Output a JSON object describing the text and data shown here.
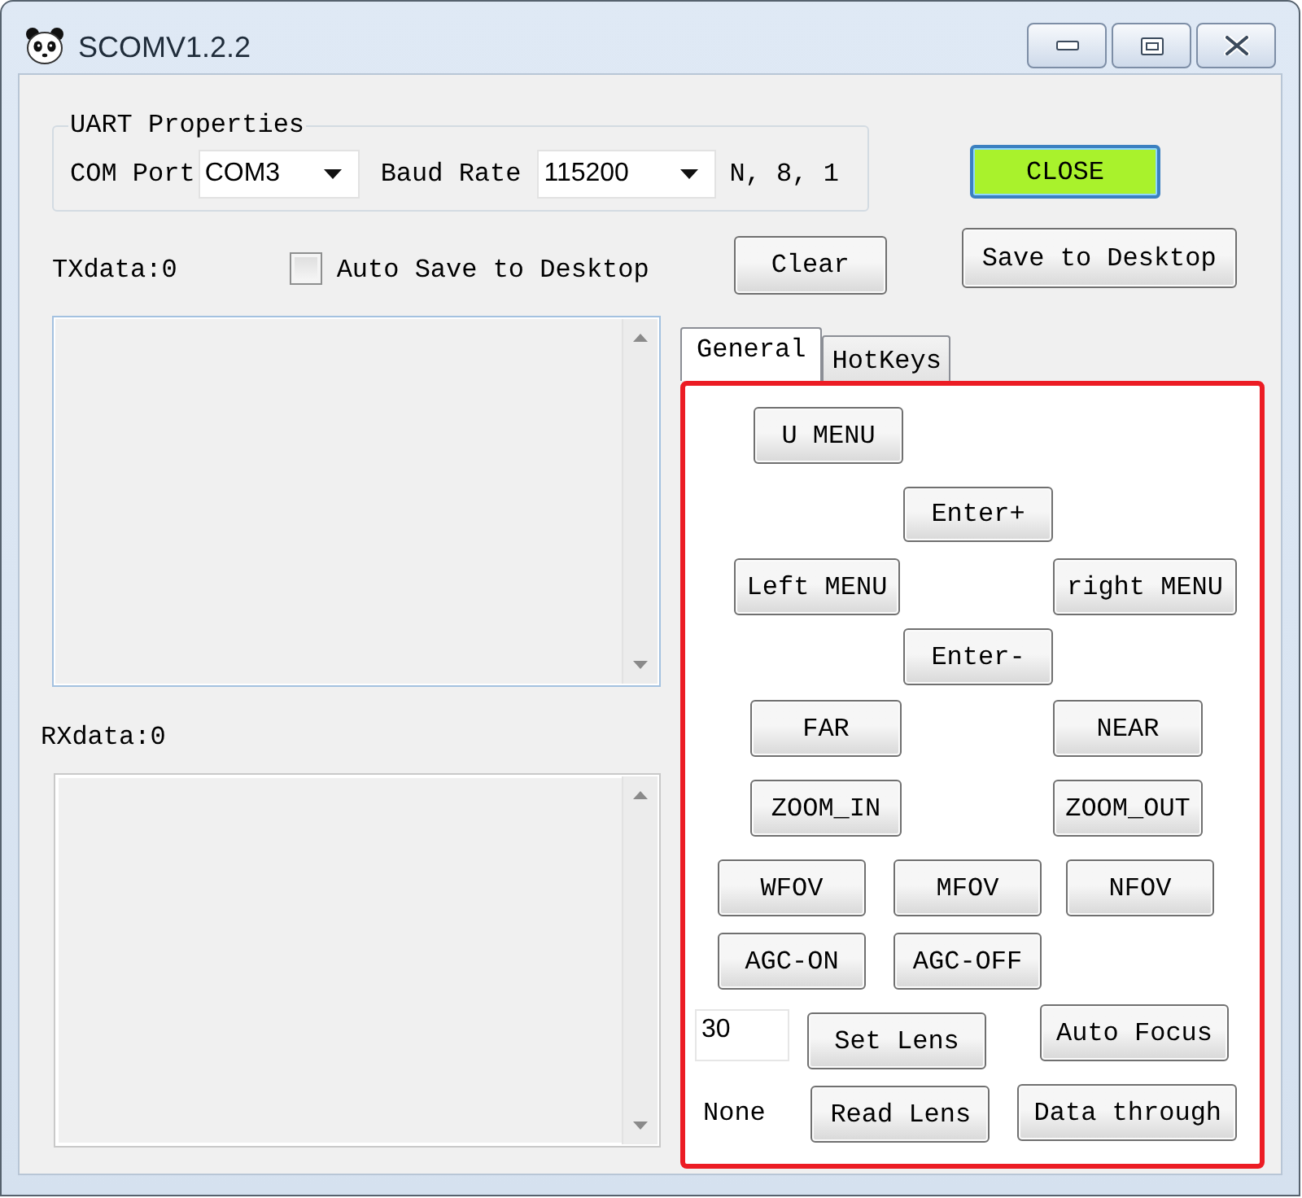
{
  "window": {
    "title": "SCOMV1.2.2"
  },
  "uart_properties": {
    "title": "UART Properties",
    "com_port": {
      "label": "COM Port",
      "value": "COM3"
    },
    "baud_rate": {
      "label": "Baud Rate",
      "value": "115200"
    },
    "format": "N, 8, 1"
  },
  "close_button": {
    "label": "CLOSE",
    "active": true
  },
  "tx": {
    "label": "TXdata:0"
  },
  "auto_save": {
    "label": "Auto Save to Desktop",
    "checked": false
  },
  "clear_button": {
    "label": "Clear"
  },
  "save_button": {
    "label": "Save to Desktop"
  },
  "rx": {
    "label": "RXdata:0"
  },
  "tabs": [
    {
      "label": "General",
      "selected": true
    },
    {
      "label": "HotKeys",
      "selected": false
    }
  ],
  "general_panel": {
    "highlighted": true,
    "rows": [
      [
        {
          "kind": "button",
          "label": "U MENU"
        }
      ],
      [
        {
          "kind": "button",
          "label": "Enter+"
        }
      ],
      [
        {
          "kind": "button",
          "label": "Left MENU"
        },
        {
          "kind": "button",
          "label": "right MENU"
        }
      ],
      [
        {
          "kind": "button",
          "label": "Enter-"
        }
      ],
      [
        {
          "kind": "button",
          "label": "FAR"
        },
        {
          "kind": "button",
          "label": "NEAR"
        }
      ],
      [
        {
          "kind": "button",
          "label": "ZOOM_IN"
        },
        {
          "kind": "button",
          "label": "ZOOM_OUT"
        }
      ],
      [
        {
          "kind": "button",
          "label": "WFOV"
        },
        {
          "kind": "button",
          "label": "MFOV"
        },
        {
          "kind": "button",
          "label": "NFOV"
        }
      ],
      [
        {
          "kind": "button",
          "label": "AGC-ON"
        },
        {
          "kind": "button",
          "label": "AGC-OFF"
        }
      ],
      [
        {
          "kind": "input",
          "value": "30"
        },
        {
          "kind": "button",
          "label": "Set Lens"
        },
        {
          "kind": "button",
          "label": "Auto Focus"
        }
      ],
      [
        {
          "kind": "text",
          "text": "None"
        },
        {
          "kind": "button",
          "label": "Read Lens"
        },
        {
          "kind": "button",
          "label": "Data through"
        }
      ]
    ]
  }
}
